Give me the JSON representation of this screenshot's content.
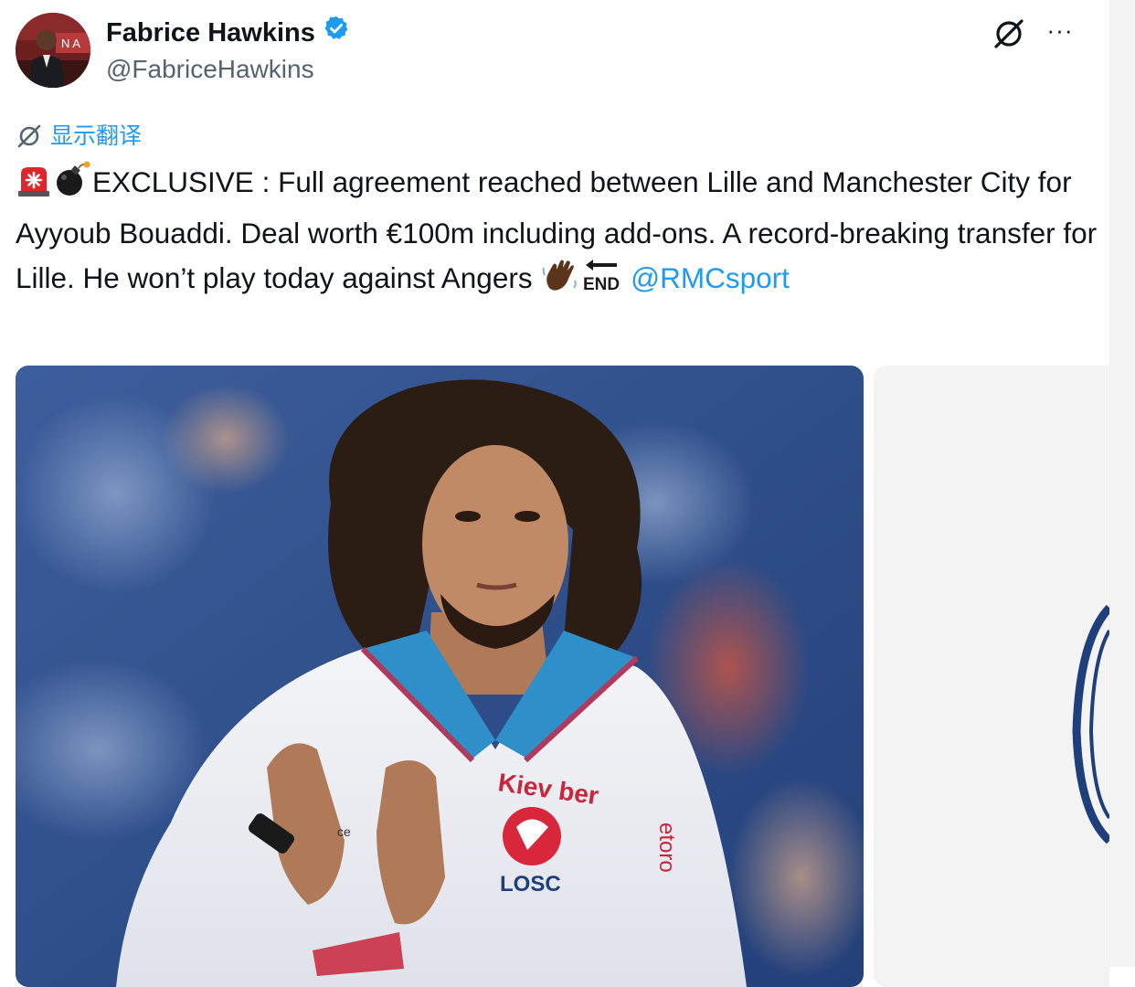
{
  "author": {
    "display_name": "Fabrice Hawkins",
    "handle": "@FabriceHawkins",
    "verified": true,
    "avatar_text": "N A"
  },
  "actions": {
    "grok_icon": "grok-icon",
    "more_label": "···"
  },
  "translate": {
    "label": "显示翻译"
  },
  "tweet": {
    "text_line1": "EXCLUSIVE : Full agreement reached between Lille and",
    "text_rest": "Manchester City for Ayyoub Bouaddi. Deal worth €100m including add-ons. A record-breaking transfer for Lille. He won’t play today against Angers",
    "end_label": "END",
    "mention": "@RMCsport",
    "emojis": [
      "police-light-emoji",
      "bomb-emoji",
      "waving-hand-emoji",
      "end-arrow-emoji"
    ]
  },
  "media": {
    "photo_text": {
      "sponsor": "Kiev ber",
      "club": "LOSC",
      "sleeve_sponsor": "etoro",
      "partial": "ce"
    }
  },
  "colors": {
    "link": "#1d9bf0",
    "verified": "#1d9bf0",
    "secondary_text": "#536471",
    "text": "#0f1419"
  }
}
